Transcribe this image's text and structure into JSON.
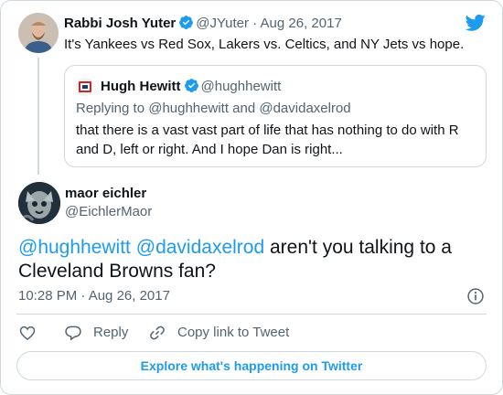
{
  "parent": {
    "name": "Rabbi Josh Yuter",
    "handle": "@JYuter",
    "separator": "·",
    "date": "Aug 26, 2017",
    "text": "It's Yankees vs Red Sox, Lakers vs. Celtics, and NY Jets vs hope."
  },
  "quoted": {
    "name": "Hugh Hewitt",
    "handle": "@hughhewitt",
    "replying_to": "Replying to @hughhewitt and @davidaxelrod",
    "text": "that there is a vast vast part of life that has nothing to do with R and D, left or right.  And I hope Dan is right..."
  },
  "main": {
    "name": "maor eichler",
    "handle": "@EichlerMaor",
    "mention1": "@hughhewitt",
    "mention2": "@davidaxelrod",
    "text": "aren't you talking to a Cleveland Browns fan?",
    "timestamp": "10:28 PM · Aug 26, 2017"
  },
  "actions": {
    "reply": "Reply",
    "copy_link": "Copy link to Tweet"
  },
  "explore_label": "Explore what's happening on Twitter",
  "colors": {
    "accent": "#1d9bf0",
    "muted": "#536471",
    "border": "#cfd9de",
    "text": "#0f1419"
  },
  "icons": [
    "twitter-bird-icon",
    "verified-badge-icon",
    "info-icon",
    "heart-icon",
    "reply-bubble-icon",
    "link-icon"
  ]
}
